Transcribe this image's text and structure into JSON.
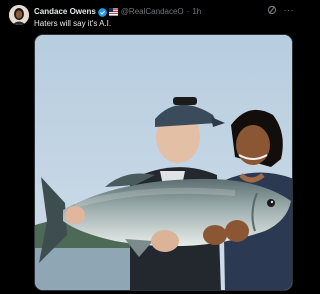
{
  "tweet": {
    "author_name": "Candace Owens",
    "author_handle": "@RealCandaceO",
    "separator": "·",
    "timestamp": "1h",
    "text": "Haters will say it's A.I.",
    "more_label": "···"
  },
  "icons": {
    "verified": "verified-badge-icon",
    "affiliation": "flag-icon",
    "grok": "grok-icon",
    "more": "more-icon"
  },
  "colors": {
    "background": "#000000",
    "primary_text": "#e7e9ea",
    "secondary_text": "#71767b",
    "verified_blue": "#1d9bf0"
  }
}
